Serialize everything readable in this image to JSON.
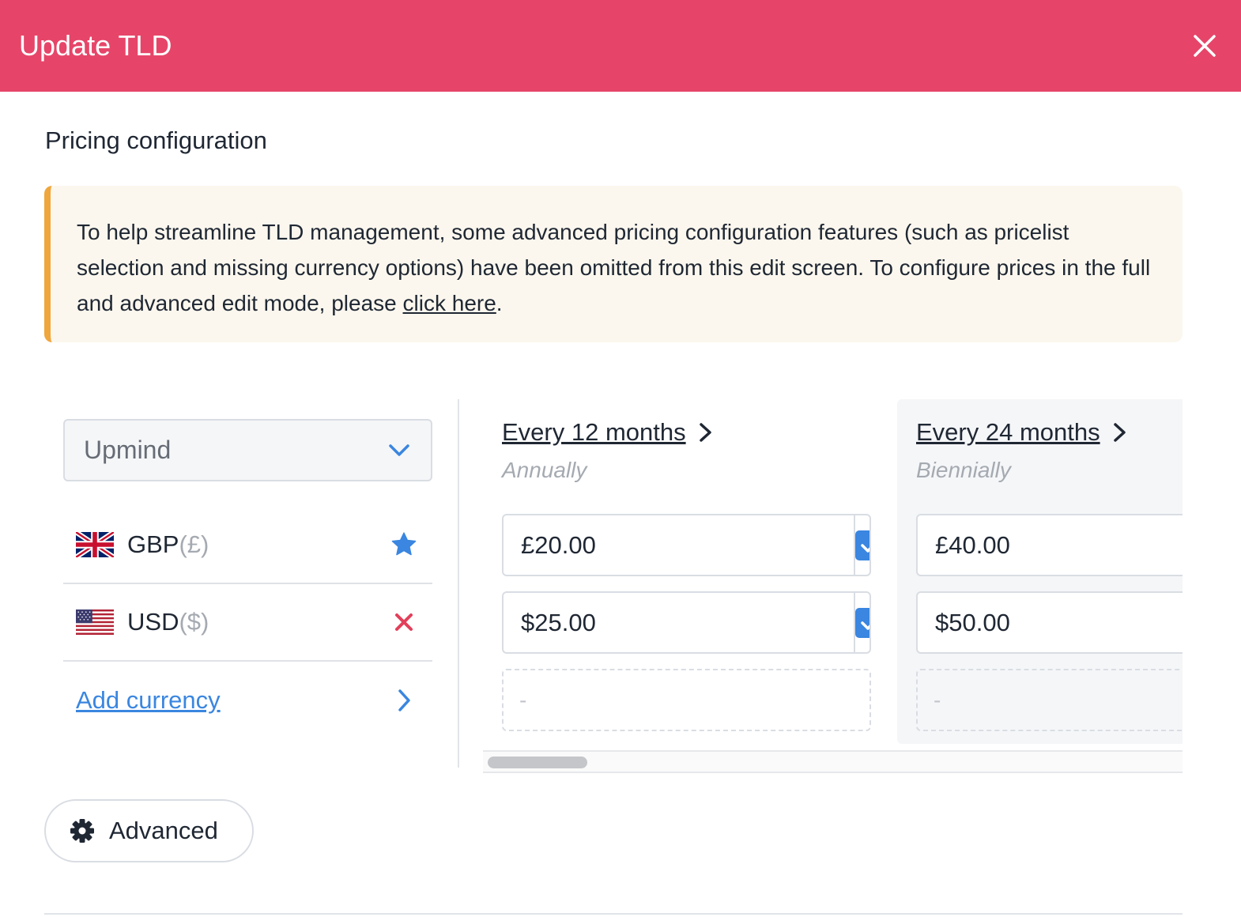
{
  "header": {
    "title": "Update TLD",
    "close_icon": "close-icon"
  },
  "section": {
    "title": "Pricing configuration"
  },
  "alert": {
    "text_before": "To help streamline TLD management, some advanced pricing configuration features (such as pricelist selection and missing currency options) have been omitted from this edit screen. To configure prices in the full and advanced edit mode, please ",
    "link_text": "click here",
    "text_after": ".",
    "accent_color": "#efa63d"
  },
  "pricelist_select": {
    "value": "Upmind",
    "icon": "chevron-down-icon"
  },
  "currencies": [
    {
      "code": "GBP",
      "symbol": "(£)",
      "flag": "uk-flag-icon",
      "action_icon": "star-icon",
      "action": "default"
    },
    {
      "code": "USD",
      "symbol": "($)",
      "flag": "us-flag-icon",
      "action_icon": "remove-icon",
      "action": "remove"
    }
  ],
  "add_currency": {
    "label": "Add currency",
    "icon": "chevron-right-icon"
  },
  "periods": [
    {
      "label": "Every 12 months",
      "sub": "Annually",
      "prices": [
        "£20.00",
        "$25.00"
      ],
      "checked": [
        true,
        true
      ],
      "empty_placeholder": "-"
    },
    {
      "label": "Every 24 months",
      "sub": "Biennially",
      "prices": [
        "£40.00",
        "$50.00"
      ],
      "empty_placeholder": "-"
    }
  ],
  "advanced_button": {
    "label": "Advanced",
    "icon": "gear-icon"
  },
  "colors": {
    "header_bg": "#e64569",
    "link_blue": "#3a86e0",
    "danger_red": "#e2405b",
    "alert_bg": "#fbf7ee"
  }
}
